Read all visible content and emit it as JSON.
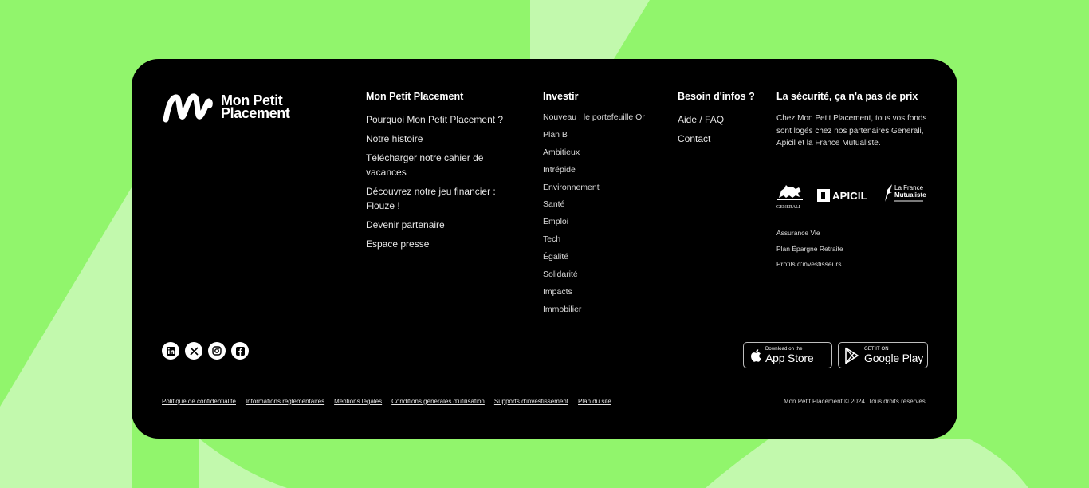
{
  "colors": {
    "background": "#91f56c",
    "background_light": "#c2f9ad",
    "card": "#000000",
    "text": "#ffffff"
  },
  "brand": {
    "name_line1": "Mon Petit",
    "name_line2": "Placement",
    "logo_icon": "mpp-m-logo-icon"
  },
  "columns": {
    "mpp": {
      "title": "Mon Petit Placement",
      "links": [
        "Pourquoi Mon Petit Placement ?",
        "Notre histoire",
        "Télécharger notre cahier de vacances",
        "Découvrez notre jeu financier : Flouze !",
        "Devenir partenaire",
        "Espace presse"
      ]
    },
    "invest": {
      "title": "Investir",
      "links": [
        "Nouveau : le portefeuille Or",
        "Plan B",
        "Ambitieux",
        "Intrépide",
        "Environnement",
        "Santé",
        "Emploi",
        "Tech",
        "Égalité",
        "Solidarité",
        "Impacts",
        "Immobilier"
      ]
    },
    "help": {
      "title": "Besoin d'infos ?",
      "links": [
        "Aide / FAQ",
        "Contact"
      ]
    },
    "security": {
      "title": "La sécurité, ça n'a pas de prix",
      "text": "Chez Mon Petit Placement, tous vos fonds sont logés chez nos partenaires Generali, Apicil et la France Mutualiste.",
      "partners": {
        "generali": "GENERALI",
        "apicil": "APICIL",
        "lfm_line1": "La France",
        "lfm_line2": "Mutualiste"
      },
      "links": [
        "Assurance Vie",
        "Plan Épargne Retraite",
        "Profils d'investisseurs"
      ]
    }
  },
  "socials": [
    "linkedin-icon",
    "x-icon",
    "instagram-icon",
    "facebook-icon"
  ],
  "stores": {
    "apple": {
      "small": "Download on the",
      "big": "App Store"
    },
    "google": {
      "small": "GET IT ON",
      "big": "Google Play"
    }
  },
  "legal_links": [
    "Politique de confidentialité",
    "Informations réglementaires",
    "Mentions légales",
    "Conditions générales d'utilisation",
    "Supports d'investissement",
    "Plan du site"
  ],
  "copyright": "Mon Petit Placement © 2024. Tous droits réservés."
}
